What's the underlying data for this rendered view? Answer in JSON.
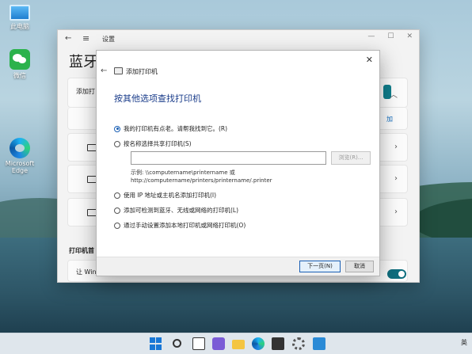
{
  "desktop": {
    "icons": [
      {
        "label": "此电脑"
      },
      {
        "label": "微信"
      },
      {
        "label": "Microsoft Edge"
      }
    ]
  },
  "settings": {
    "title": "设置",
    "heading": "蓝牙",
    "panel1_label": "添加打",
    "link_partial": "加",
    "section_label": "打印机首",
    "bottom_label": "让 Win"
  },
  "dialog": {
    "title": "添加打印机",
    "heading": "按其他选项查找打印机",
    "options": [
      {
        "label": "我的打印机有点老。请帮我找到它。(R)",
        "checked": true
      },
      {
        "label": "按名称选择共享打印机(S)",
        "checked": false
      },
      {
        "label": "使用 IP 地址或主机名添加打印机(I)",
        "checked": false
      },
      {
        "label": "添加可检测到蓝牙、无线或网络的打印机(L)",
        "checked": false
      },
      {
        "label": "通过手动设置添加本地打印机或网络打印机(O)",
        "checked": false
      }
    ],
    "share_input_value": "",
    "browse_label": "浏览(R)...",
    "example_line1": "示例: \\\\computername\\printername 或",
    "example_line2": "http://computername/printers/printername/.printer",
    "next_label": "下一页(N)",
    "cancel_label": "取消"
  },
  "taskbar": {
    "ime_label": "英"
  },
  "colors": {
    "accent": "#1a5fb4",
    "heading_blue": "#1a3c8a",
    "toggle_on": "#0f6e7e",
    "windows_blue": "#1877d6"
  }
}
